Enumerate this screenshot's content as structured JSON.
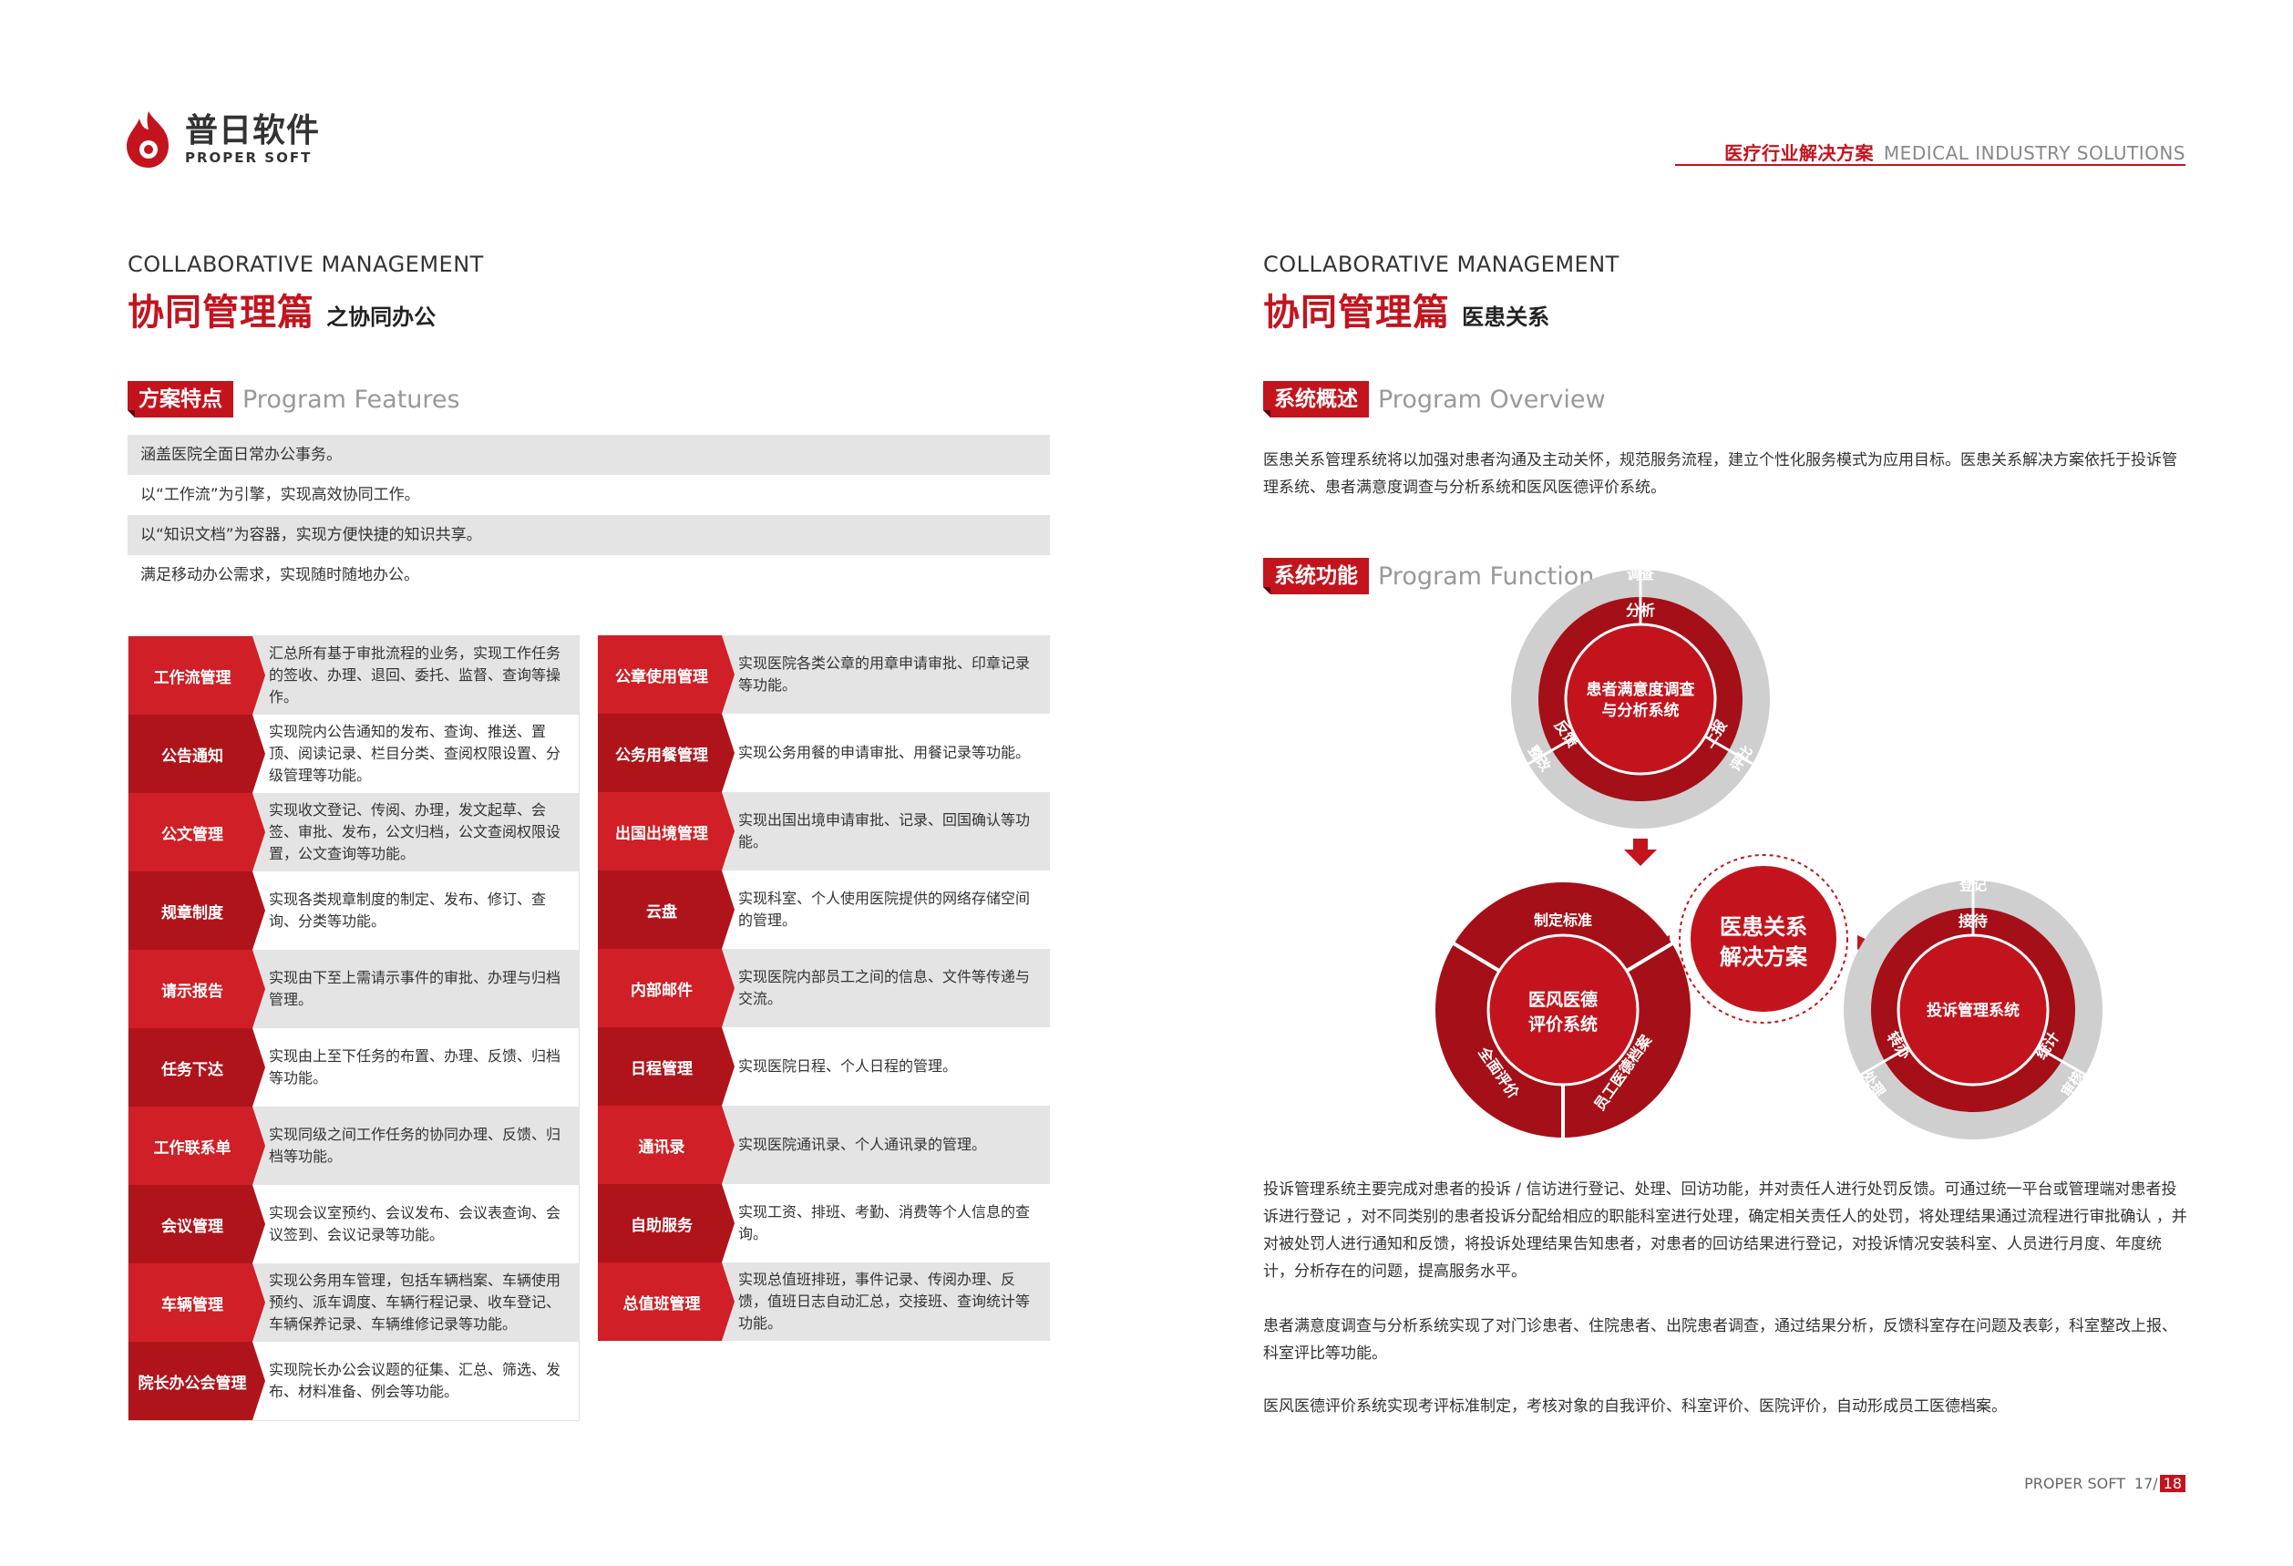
{
  "brand": {
    "name_cn": "普日软件",
    "name_en": "PROPER SOFT",
    "color": "#c3141e"
  },
  "header": {
    "solution_cn": "医疗行业解决方案",
    "solution_en": "MEDICAL INDUSTRY SOLUTIONS"
  },
  "left": {
    "section_en": "COLLABORATIVE MANAGEMENT",
    "section_cn": "协同管理篇",
    "section_sub": "之协同办公",
    "features_tag": "方案特点",
    "features_en": "Program Features",
    "features": [
      "涵盖医院全面日常办公事务。",
      "以“工作流”为引擎，实现高效协同工作。",
      "以“知识文档”为容器，实现方便快捷的知识共享。",
      "满足移动办公需求，实现随时随地办公。"
    ],
    "modules_left": [
      {
        "label": "工作流管理",
        "desc": "汇总所有基于审批流程的业务，实现工作任务的签收、办理、退回、委托、监督、查询等操作。"
      },
      {
        "label": "公告通知",
        "desc": "实现院内公告通知的发布、查询、推送、置顶、阅读记录、栏目分类、查阅权限设置、分级管理等功能。"
      },
      {
        "label": "公文管理",
        "desc": "实现收文登记、传阅、办理，发文起草、会签、审批、发布，公文归档，公文查阅权限设置，公文查询等功能。"
      },
      {
        "label": "规章制度",
        "desc": "实现各类规章制度的制定、发布、修订、查询、分类等功能。"
      },
      {
        "label": "请示报告",
        "desc": "实现由下至上需请示事件的审批、办理与归档管理。"
      },
      {
        "label": "任务下达",
        "desc": "实现由上至下任务的布置、办理、反馈、归档等功能。"
      },
      {
        "label": "工作联系单",
        "desc": "实现同级之间工作任务的协同办理、反馈、归档等功能。"
      },
      {
        "label": "会议管理",
        "desc": "实现会议室预约、会议发布、会议表查询、会议签到、会议记录等功能。"
      },
      {
        "label": "车辆管理",
        "desc": "实现公务用车管理，包括车辆档案、车辆使用预约、派车调度、车辆行程记录、收车登记、车辆保养记录、车辆维修记录等功能。"
      },
      {
        "label": "院长办公会管理",
        "desc": "实现院长办公会议题的征集、汇总、筛选、发布、材料准备、例会等功能。"
      }
    ],
    "modules_right": [
      {
        "label": "公章使用管理",
        "desc": "实现医院各类公章的用章申请审批、印章记录等功能。"
      },
      {
        "label": "公务用餐管理",
        "desc": "实现公务用餐的申请审批、用餐记录等功能。"
      },
      {
        "label": "出国出境管理",
        "desc": "实现出国出境申请审批、记录、回国确认等功能。"
      },
      {
        "label": "云盘",
        "desc": "实现科室、个人使用医院提供的网络存储空间的管理。"
      },
      {
        "label": "内部邮件",
        "desc": "实现医院内部员工之间的信息、文件等传递与交流。"
      },
      {
        "label": "日程管理",
        "desc": "实现医院日程、个人日程的管理。"
      },
      {
        "label": "通讯录",
        "desc": "实现医院通讯录、个人通讯录的管理。"
      },
      {
        "label": "自助服务",
        "desc": "实现工资、排班、考勤、消费等个人信息的查询。"
      },
      {
        "label": "总值班管理",
        "desc": "实现总值班排班，事件记录、传阅办理、反馈，值班日志自动汇总，交接班、查询统计等功能。"
      }
    ]
  },
  "right": {
    "section_en": "COLLABORATIVE MANAGEMENT",
    "section_cn": "协同管理篇",
    "section_sub": "医患关系",
    "overview_tag": "系统概述",
    "overview_en": "Program Overview",
    "overview_text": "医患关系管理系统将以加强对患者沟通及主动关怀，规范服务流程，建立个性化服务模式为应用目标。医患关系解决方案依托于投诉管理系统、患者满意度调查与分析系统和医风医德评价系统。",
    "function_tag": "系统功能",
    "function_en": "Program Function",
    "diagram": {
      "center": [
        "医患关系",
        "解决方案"
      ],
      "top": {
        "core": [
          "患者满意度调查",
          "与分析系统"
        ],
        "inner": [
          "分析",
          "上报",
          "反馈"
        ],
        "outer": [
          "调查",
          "评比",
          "整改"
        ]
      },
      "left": {
        "core": [
          "医风医德",
          "评价系统"
        ],
        "inner": [
          "制定标准",
          "员工医德档案",
          "全面评价"
        ]
      },
      "right": {
        "core": [
          "投诉管理系统"
        ],
        "inner": [
          "接待",
          "统计",
          "转办"
        ],
        "outer": [
          "登记",
          "审核",
          "处理"
        ]
      }
    },
    "paragraphs": [
      "投诉管理系统主要完成对患者的投诉 / 信访进行登记、处理、回访功能，并对责任人进行处罚反馈。可通过统一平台或管理端对患者投诉进行登记 ，对不同类别的患者投诉分配给相应的职能科室进行处理，确定相关责任人的处罚，将处理结果通过流程进行审批确认 ，并对被处罚人进行通知和反馈，将投诉处理结果告知患者，对患者的回访结果进行登记，对投诉情况安装科室、人员进行月度、年度统计，分析存在的问题，提高服务水平。",
      "患者满意度调查与分析系统实现了对门诊患者、住院患者、出院患者调查，通过结果分析，反馈科室存在问题及表彰，科室整改上报、科室评比等功能。",
      "医风医德评价系统实现考评标准制定，考核对象的自我评价、科室评价、医院评价，自动形成员工医德档案。"
    ]
  },
  "footer": {
    "brand": "PROPER SOFT",
    "page_left": "17/",
    "page_right": "18"
  }
}
